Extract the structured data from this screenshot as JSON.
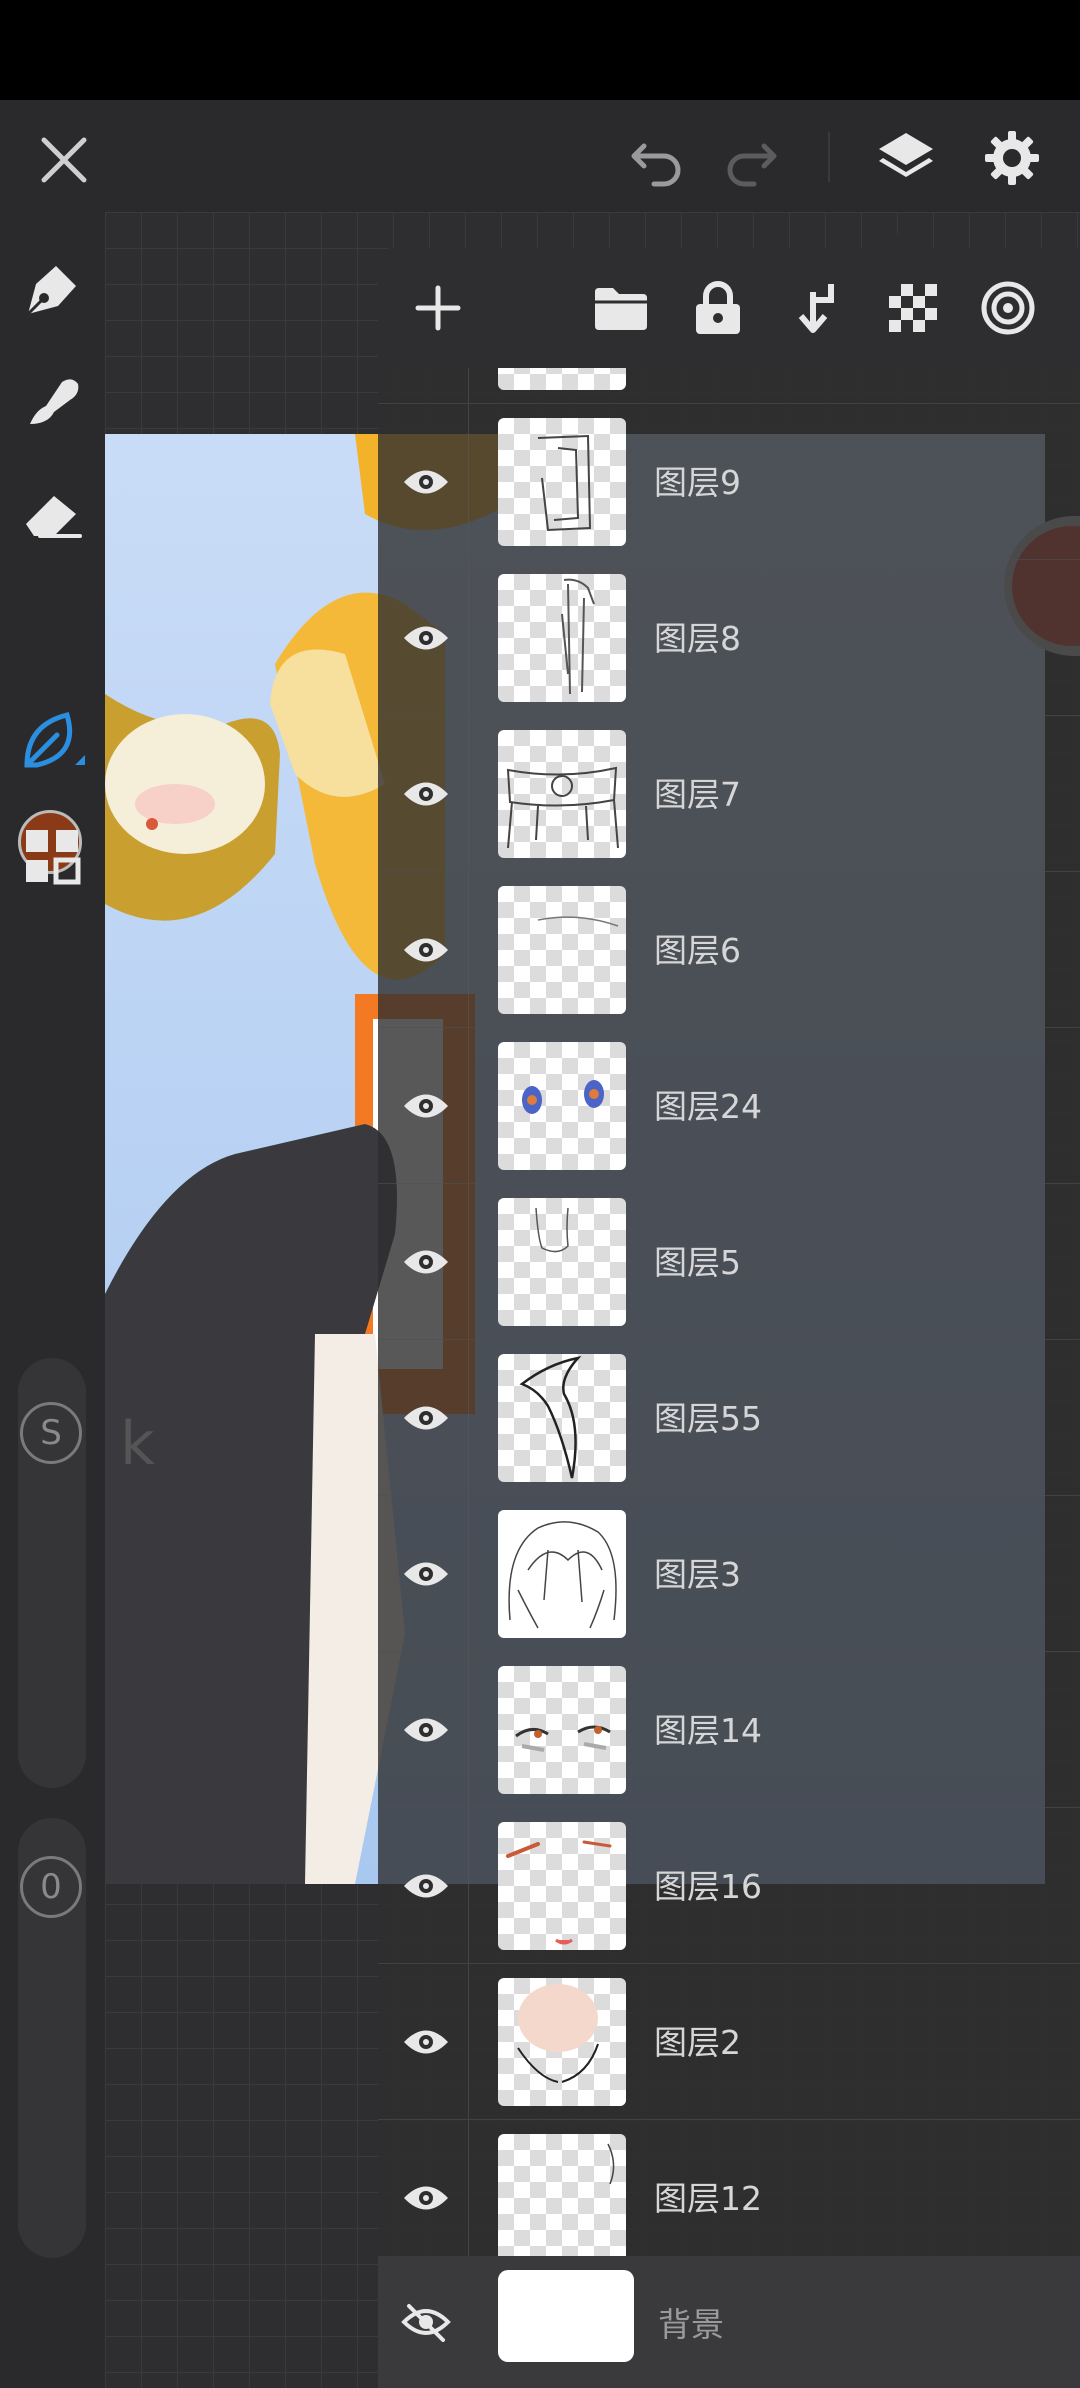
{
  "topbar": {
    "close_icon": "close-icon",
    "undo_icon": "undo-icon",
    "redo_icon": "redo-icon",
    "layers_icon": "layers-icon",
    "settings_icon": "gear-icon"
  },
  "left_toolbar": {
    "tools": [
      "pen-tool-icon",
      "smudge-tool-icon",
      "eraser-icon",
      "color-swatch",
      "blend-tool-icon",
      "grid-menu-icon"
    ],
    "current_color": "#8a3a17",
    "size_label": "S",
    "opacity_label": "0"
  },
  "layers_panel": {
    "header_buttons": [
      "add-layer",
      "folder",
      "lock",
      "merge-down",
      "transparency",
      "layer-settings"
    ],
    "layers": [
      {
        "name": "图层9",
        "visible": true
      },
      {
        "name": "图层8",
        "visible": true
      },
      {
        "name": "图层7",
        "visible": true
      },
      {
        "name": "图层6",
        "visible": true
      },
      {
        "name": "图层24",
        "visible": true
      },
      {
        "name": "图层5",
        "visible": true
      },
      {
        "name": "图层55",
        "visible": true
      },
      {
        "name": "图层3",
        "visible": true
      },
      {
        "name": "图层14",
        "visible": true
      },
      {
        "name": "图层16",
        "visible": true
      },
      {
        "name": "图层2",
        "visible": true
      },
      {
        "name": "图层12",
        "visible": true
      }
    ],
    "background": {
      "name": "背景",
      "visible": false
    }
  },
  "colors": {
    "accent_blue": "#2a8fe0",
    "record_red": "#d5482a"
  }
}
